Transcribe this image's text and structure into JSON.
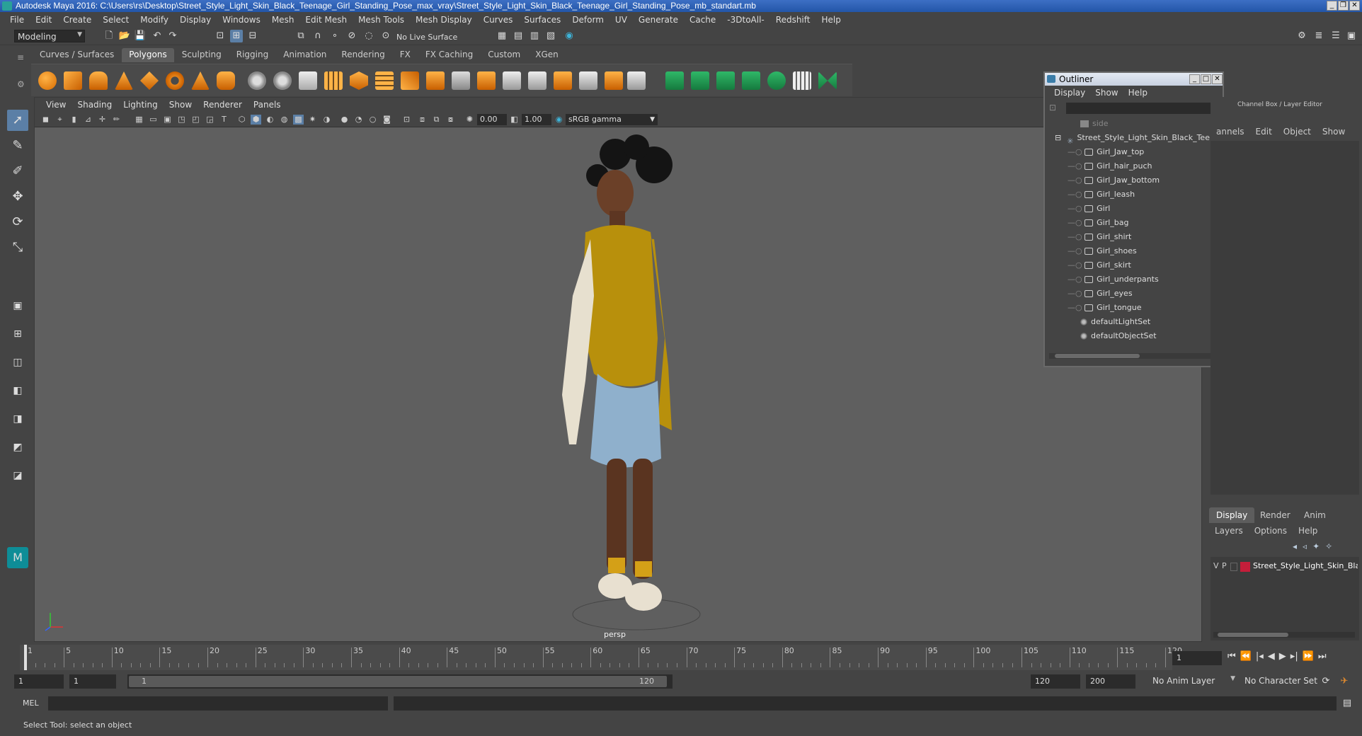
{
  "window": {
    "title": "Autodesk Maya 2016: C:\\Users\\rs\\Desktop\\Street_Style_Light_Skin_Black_Teenage_Girl_Standing_Pose_max_vray\\Street_Style_Light_Skin_Black_Teenage_Girl_Standing_Pose_mb_standart.mb"
  },
  "menubar": [
    "File",
    "Edit",
    "Create",
    "Select",
    "Modify",
    "Display",
    "Windows",
    "Mesh",
    "Edit Mesh",
    "Mesh Tools",
    "Mesh Display",
    "Curves",
    "Surfaces",
    "Deform",
    "UV",
    "Generate",
    "Cache",
    "-3DtoAll-",
    "Redshift",
    "Help"
  ],
  "statusline": {
    "mode": "Modeling",
    "live_surface": "No Live Surface"
  },
  "shelf": {
    "tabs": [
      "Curves / Surfaces",
      "Polygons",
      "Sculpting",
      "Rigging",
      "Animation",
      "Rendering",
      "FX",
      "FX Caching",
      "Custom",
      "XGen"
    ],
    "active_tab": "Polygons"
  },
  "viewport": {
    "menu": [
      "View",
      "Shading",
      "Lighting",
      "Show",
      "Renderer",
      "Panels"
    ],
    "exposure": "0.00",
    "gamma": "1.00",
    "color_space": "sRGB gamma",
    "camera": "persp"
  },
  "outliner": {
    "title": "Outliner",
    "menu": [
      "Display",
      "Show",
      "Help"
    ],
    "items": [
      {
        "label": "side",
        "indent": 0,
        "kind": "camera",
        "dim": true
      },
      {
        "label": "Street_Style_Light_Skin_Black_Tee",
        "indent": 0,
        "kind": "group"
      },
      {
        "label": "Girl_Jaw_top",
        "indent": 1,
        "kind": "mesh"
      },
      {
        "label": "Girl_hair_puch",
        "indent": 1,
        "kind": "mesh"
      },
      {
        "label": "Girl_Jaw_bottom",
        "indent": 1,
        "kind": "mesh"
      },
      {
        "label": "Girl_leash",
        "indent": 1,
        "kind": "mesh"
      },
      {
        "label": "Girl",
        "indent": 1,
        "kind": "mesh"
      },
      {
        "label": "Girl_bag",
        "indent": 1,
        "kind": "mesh"
      },
      {
        "label": "Girl_shirt",
        "indent": 1,
        "kind": "mesh"
      },
      {
        "label": "Girl_shoes",
        "indent": 1,
        "kind": "mesh"
      },
      {
        "label": "Girl_skirt",
        "indent": 1,
        "kind": "mesh"
      },
      {
        "label": "Girl_underpants",
        "indent": 1,
        "kind": "mesh"
      },
      {
        "label": "Girl_eyes",
        "indent": 1,
        "kind": "mesh"
      },
      {
        "label": "Girl_tongue",
        "indent": 1,
        "kind": "mesh"
      },
      {
        "label": "defaultLightSet",
        "indent": 0,
        "kind": "set"
      },
      {
        "label": "defaultObjectSet",
        "indent": 0,
        "kind": "set"
      }
    ]
  },
  "channelbox": {
    "title": "Channel Box / Layer Editor",
    "menu": [
      "annels",
      "Edit",
      "Object",
      "Show"
    ]
  },
  "layers": {
    "tabs": [
      "Display",
      "Render",
      "Anim"
    ],
    "active_tab": "Display",
    "menu": [
      "Layers",
      "Options",
      "Help"
    ],
    "layer_row": {
      "v": "V",
      "p": "P",
      "name": "Street_Style_Light_Skin_Black",
      "color": "#c41e3a"
    }
  },
  "timeline": {
    "ticks": [
      1,
      5,
      10,
      15,
      20,
      25,
      30,
      35,
      40,
      45,
      50,
      55,
      60,
      65,
      70,
      75,
      80,
      85,
      90,
      95,
      100,
      105,
      110,
      115,
      120
    ],
    "current_frame": "1"
  },
  "range": {
    "start": "1",
    "anim_start": "1",
    "slider_start": "1",
    "slider_end": "120",
    "anim_end": "120",
    "end": "200",
    "anim_layer": "No Anim Layer",
    "char_set": "No Character Set"
  },
  "cmdline": {
    "label": "MEL"
  },
  "helpline": {
    "text": "Select Tool: select an object"
  },
  "colors": {
    "accent": "#5b7fa6",
    "layer": "#c41e3a",
    "shirt": "#b8900c",
    "skirt": "#8fb0cc"
  }
}
